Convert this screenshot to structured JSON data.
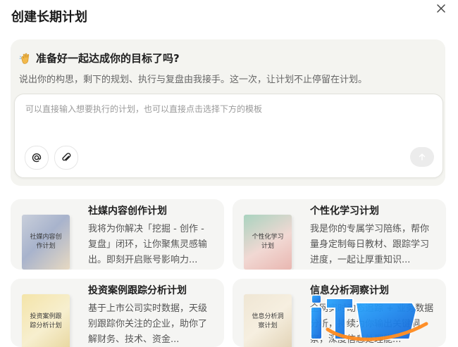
{
  "dialog": {
    "title": "创建长期计划"
  },
  "hero": {
    "title": "准备好一起达成你的目标了吗?",
    "subtitle": "说出你的构思，剩下的规划、执行与复盘由我接手。这一次，让计划不止停留在计划。",
    "emoji_icon": "waving-hand-icon"
  },
  "composer": {
    "placeholder": "可以直接输入想要执行的计划，也可以直接点击选择下方的模板",
    "value": ""
  },
  "templates": [
    {
      "title": "社媒内容创作计划",
      "cover_text": "社媒内容创作计划",
      "description": "我将为你解决「挖掘 - 创作 - 复盘」闭环，让你聚焦灵感输出。即刻开启账号影响力..."
    },
    {
      "title": "个性化学习计划",
      "cover_text": "个性化学习计划",
      "description": "我是你的专属学习陪练，帮你量身定制每日教材、跟踪学习进度，一起让厚重知识..."
    },
    {
      "title": "投资案例跟踪分析计划",
      "cover_text": "投资案例跟踪分析计划",
      "description": "基于上市公司实时数据，天级别跟踪你关注的企业，助你了解财务、技术、资金..."
    },
    {
      "title": "信息分析洞察计划",
      "cover_text": "信息分析洞察计划",
      "description": "全网实时动态追踪 + 业务数据分析，持续为你输出关键洞察，深度信息处理能..."
    }
  ],
  "watermark": {
    "text": "IT前沿"
  }
}
